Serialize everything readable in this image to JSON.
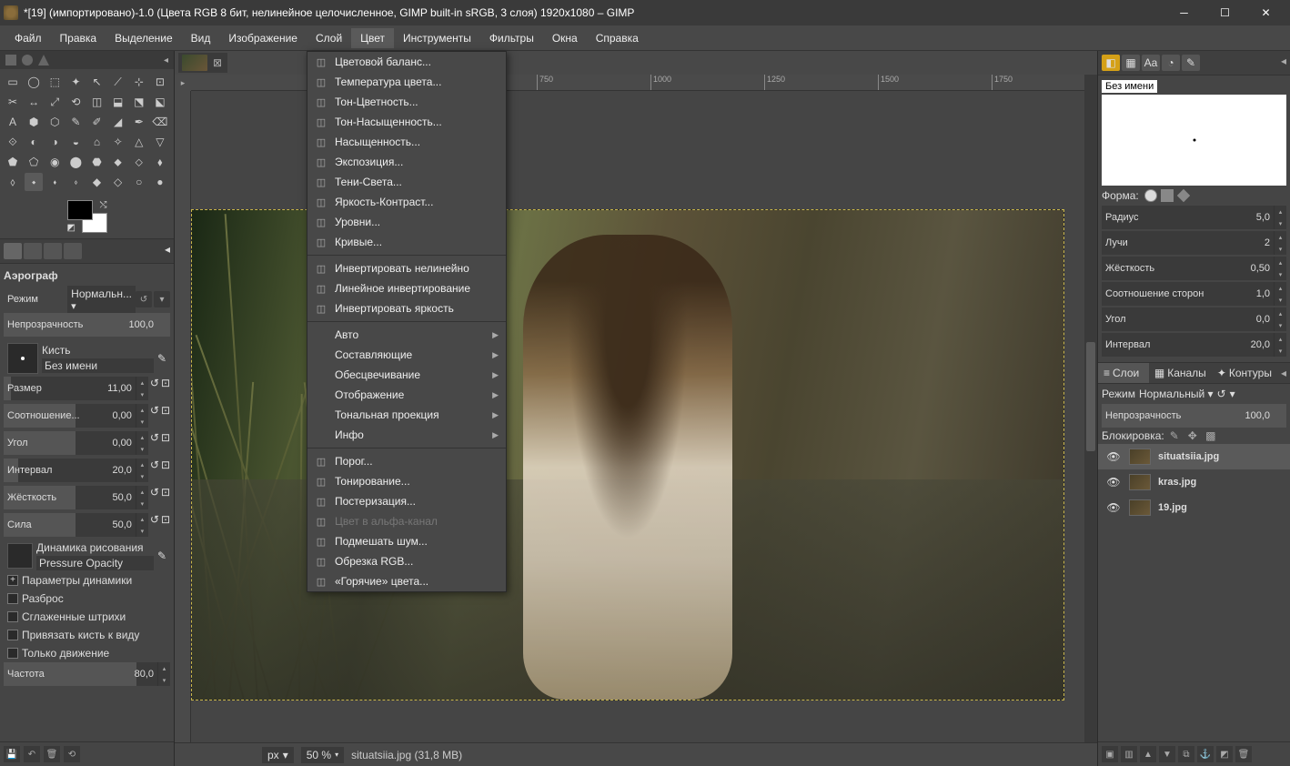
{
  "titlebar": {
    "title": "*[19] (импортировано)-1.0 (Цвета RGB 8 бит, нелинейное целочисленное, GIMP built-in sRGB, 3 слоя) 1920x1080 – GIMP"
  },
  "menubar": {
    "items": [
      "Файл",
      "Правка",
      "Выделение",
      "Вид",
      "Изображение",
      "Слой",
      "Цвет",
      "Инструменты",
      "Фильтры",
      "Окна",
      "Справка"
    ],
    "active_index": 6
  },
  "dropdown": {
    "groups": [
      [
        {
          "label": "Цветовой баланс...",
          "icon": "balance"
        },
        {
          "label": "Температура цвета...",
          "icon": "temp"
        },
        {
          "label": "Тон-Цветность...",
          "icon": "hue"
        },
        {
          "label": "Тон-Насыщенность...",
          "icon": "hsl"
        },
        {
          "label": "Насыщенность...",
          "icon": "sat"
        },
        {
          "label": "Экспозиция...",
          "icon": "expo"
        },
        {
          "label": "Тени-Света...",
          "icon": "shadow"
        },
        {
          "label": "Яркость-Контраст...",
          "icon": "bc"
        },
        {
          "label": "Уровни...",
          "icon": "levels"
        },
        {
          "label": "Кривые...",
          "icon": "curves"
        }
      ],
      [
        {
          "label": "Инвертировать нелинейно",
          "icon": "invert"
        },
        {
          "label": "Линейное инвертирование",
          "icon": "linvert"
        },
        {
          "label": "Инвертировать яркость",
          "icon": "vinvert"
        }
      ],
      [
        {
          "label": "Авто",
          "submenu": true
        },
        {
          "label": "Составляющие",
          "submenu": true
        },
        {
          "label": "Обесцвечивание",
          "submenu": true
        },
        {
          "label": "Отображение",
          "submenu": true
        },
        {
          "label": "Тональная проекция",
          "submenu": true
        },
        {
          "label": "Инфо",
          "submenu": true
        }
      ],
      [
        {
          "label": "Порог...",
          "icon": "thresh"
        },
        {
          "label": "Тонирование...",
          "icon": "tint"
        },
        {
          "label": "Постеризация...",
          "icon": "poster"
        },
        {
          "label": "Цвет в альфа-канал",
          "icon": "c2a",
          "disabled": true
        },
        {
          "label": "Подмешать шум...",
          "icon": "noise"
        },
        {
          "label": "Обрезка RGB...",
          "icon": "rgbclip"
        },
        {
          "label": "«Горячие» цвета...",
          "icon": "hot"
        }
      ]
    ]
  },
  "toolbox": {
    "section_title": "Аэрограф",
    "mode_label": "Режим",
    "mode_value": "Нормальн...",
    "options": [
      {
        "label": "Непрозрачность",
        "value": "100,0",
        "fill": 100
      },
      {
        "label": "Размер",
        "value": "11,00",
        "fill": 5
      },
      {
        "label": "Соотношение...",
        "value": "0,00",
        "fill": 50
      },
      {
        "label": "Угол",
        "value": "0,00",
        "fill": 50
      },
      {
        "label": "Интервал",
        "value": "20,0",
        "fill": 10
      },
      {
        "label": "Жёсткость",
        "value": "50,0",
        "fill": 50
      },
      {
        "label": "Сила",
        "value": "50,0",
        "fill": 50
      }
    ],
    "brush_label": "Кисть",
    "brush_name": "Без имени",
    "dynamics_label": "Динамика рисования",
    "dynamics_value": "Pressure Opacity",
    "checks": [
      {
        "label": "Параметры динамики",
        "plus": true
      },
      {
        "label": "Разброс"
      },
      {
        "label": "Сглаженные штрихи"
      },
      {
        "label": "Привязать кисть к виду"
      },
      {
        "label": "Только движение"
      }
    ],
    "freq_label": "Частота",
    "freq_value": "80,0"
  },
  "ruler_ticks": [
    "750",
    "1000",
    "1250",
    "1500",
    "1750"
  ],
  "statusbar": {
    "unit": "px",
    "zoom": "50 %",
    "file_info": "situatsiia.jpg (31,8 MB)"
  },
  "right_panel": {
    "brush_name": "Без имени",
    "shape_label": "Форма:",
    "sliders": [
      {
        "label": "Радиус",
        "value": "5,0"
      },
      {
        "label": "Лучи",
        "value": "2"
      },
      {
        "label": "Жёсткость",
        "value": "0,50"
      },
      {
        "label": "Соотношение сторон",
        "value": "1,0"
      },
      {
        "label": "Угол",
        "value": "0,0"
      },
      {
        "label": "Интервал",
        "value": "20,0"
      }
    ],
    "layer_tabs": [
      "Слои",
      "Каналы",
      "Контуры"
    ],
    "mode_label": "Режим",
    "mode_value": "Нормальный",
    "opacity_label": "Непрозрачность",
    "opacity_value": "100,0",
    "lock_label": "Блокировка:",
    "layers": [
      {
        "name": "situatsiia.jpg",
        "selected": true
      },
      {
        "name": "kras.jpg"
      },
      {
        "name": "19.jpg"
      }
    ]
  }
}
